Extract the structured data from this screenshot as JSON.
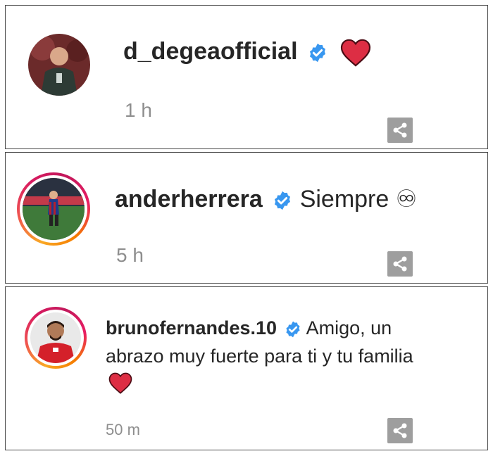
{
  "comments": [
    {
      "username": "d_degeaofficial",
      "text": "",
      "time": "1 h",
      "verified": true,
      "emoji": "red-heart",
      "ring": false
    },
    {
      "username": "anderherrera",
      "text": "Siempre ♾",
      "time": "5 h",
      "verified": true,
      "ring": true
    },
    {
      "username": "brunofernandes.10",
      "text_line1": "Amigo, un",
      "text_line2": "abrazo muy fuerte para ti y tu familia",
      "time": "50 m",
      "verified": true,
      "emoji": "red-heart",
      "ring": true
    }
  ],
  "colors": {
    "verified_badge": "#3897f0",
    "heart": "#e0245e",
    "share_button": "#9e9e9e",
    "timestamp": "#8e8e8e",
    "text": "#262626"
  },
  "icons": [
    "verified-badge-icon",
    "heart-icon",
    "share-icon"
  ]
}
